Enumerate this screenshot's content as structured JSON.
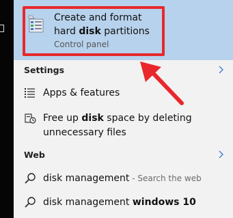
{
  "best_match": {
    "title_pre": "Create and format",
    "title_line2_pre": "hard ",
    "title_bold": "disk",
    "title_post": " partitions",
    "subtitle": "Control panel"
  },
  "settings": {
    "header": "Settings",
    "items": [
      {
        "label": "Apps & features",
        "icon": "apps-features-icon"
      },
      {
        "label_pre": "Free up ",
        "label_bold": "disk",
        "label_post": " space by deleting",
        "label_line2": "unnecessary files",
        "icon": "storage-icon"
      }
    ]
  },
  "web": {
    "header": "Web",
    "items": [
      {
        "label": "disk management",
        "suffix": " - Search the web",
        "icon": "search-icon"
      },
      {
        "label": "disk management ",
        "bold": "windows 10",
        "icon": "search-icon"
      }
    ]
  },
  "colors": {
    "highlight": "#b7d2ec",
    "annotation": "#e8282c",
    "background": "#f2f2f2"
  }
}
